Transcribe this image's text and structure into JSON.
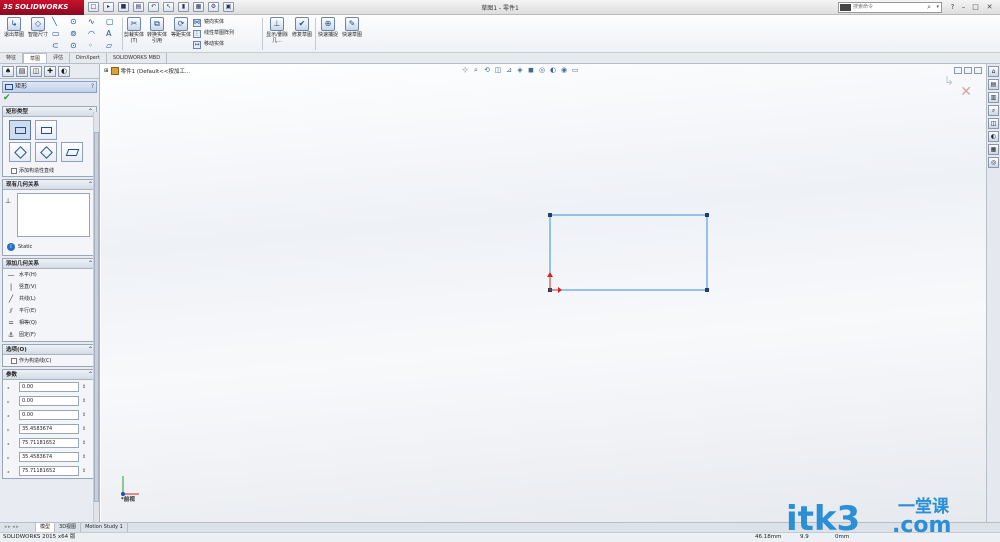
{
  "app": {
    "logo_text": "SOLIDWORKS",
    "logo_mark": "3S",
    "document_title": "草图1 - 零件1"
  },
  "search": {
    "placeholder": "搜索命令"
  },
  "commands": {
    "exit_sketch": "退出草图",
    "smart_dimension": "智能尺寸",
    "trim": "剪裁实体(T)",
    "convert": "转换实体引用",
    "offset": "等距实体",
    "mirror": "镜向实体",
    "linear_pattern": "线性草图阵列",
    "move": "移动实体",
    "display_delete": "显示/删除几...",
    "repair": "修复草图",
    "rapid_snaps": "快速捕捉",
    "rapid_sketch": "快速草图"
  },
  "tabs": [
    "特征",
    "草图",
    "评估",
    "DimXpert",
    "SOLIDWORKS MBD"
  ],
  "active_tab": 1,
  "property_manager": {
    "title": "矩形",
    "help": "?",
    "rect_type": {
      "label": "矩形类型",
      "checkbox": "添加构造性直线"
    },
    "existing_relations": {
      "label": "现有几何关系",
      "status": "Static"
    },
    "add_relations": {
      "label": "添加几何关系",
      "items": [
        "水平(H)",
        "竖直(V)",
        "共线(L)",
        "平行(E)",
        "相等(Q)",
        "固定(F)"
      ]
    },
    "options": {
      "label": "选项(O)",
      "checkbox": "作为构造线(C)"
    },
    "parameters": {
      "label": "参数",
      "values": [
        "0.00",
        "0.00",
        "0.00",
        "35.4583674",
        "75.71181652",
        "35.4583674",
        "75.71181652"
      ]
    }
  },
  "graphics": {
    "tree_label": "零件1  (Default<<按加工...",
    "view_label": "*前视"
  },
  "bottom_tabs": [
    "模型",
    "3D视图",
    "Motion Study 1"
  ],
  "status": {
    "product": "SOLIDWORKS 2015 x64 版",
    "coord1": "46.18mm",
    "coord2": "9.9",
    "coord3": "0mm"
  },
  "watermark": {
    "text": "itk3",
    "suffix": ".com",
    "cn": "一堂课"
  },
  "colors": {
    "sketch_line": "#3c8ce0",
    "accent_red": "#c8102e",
    "selection_blue": "#1d4f91"
  }
}
